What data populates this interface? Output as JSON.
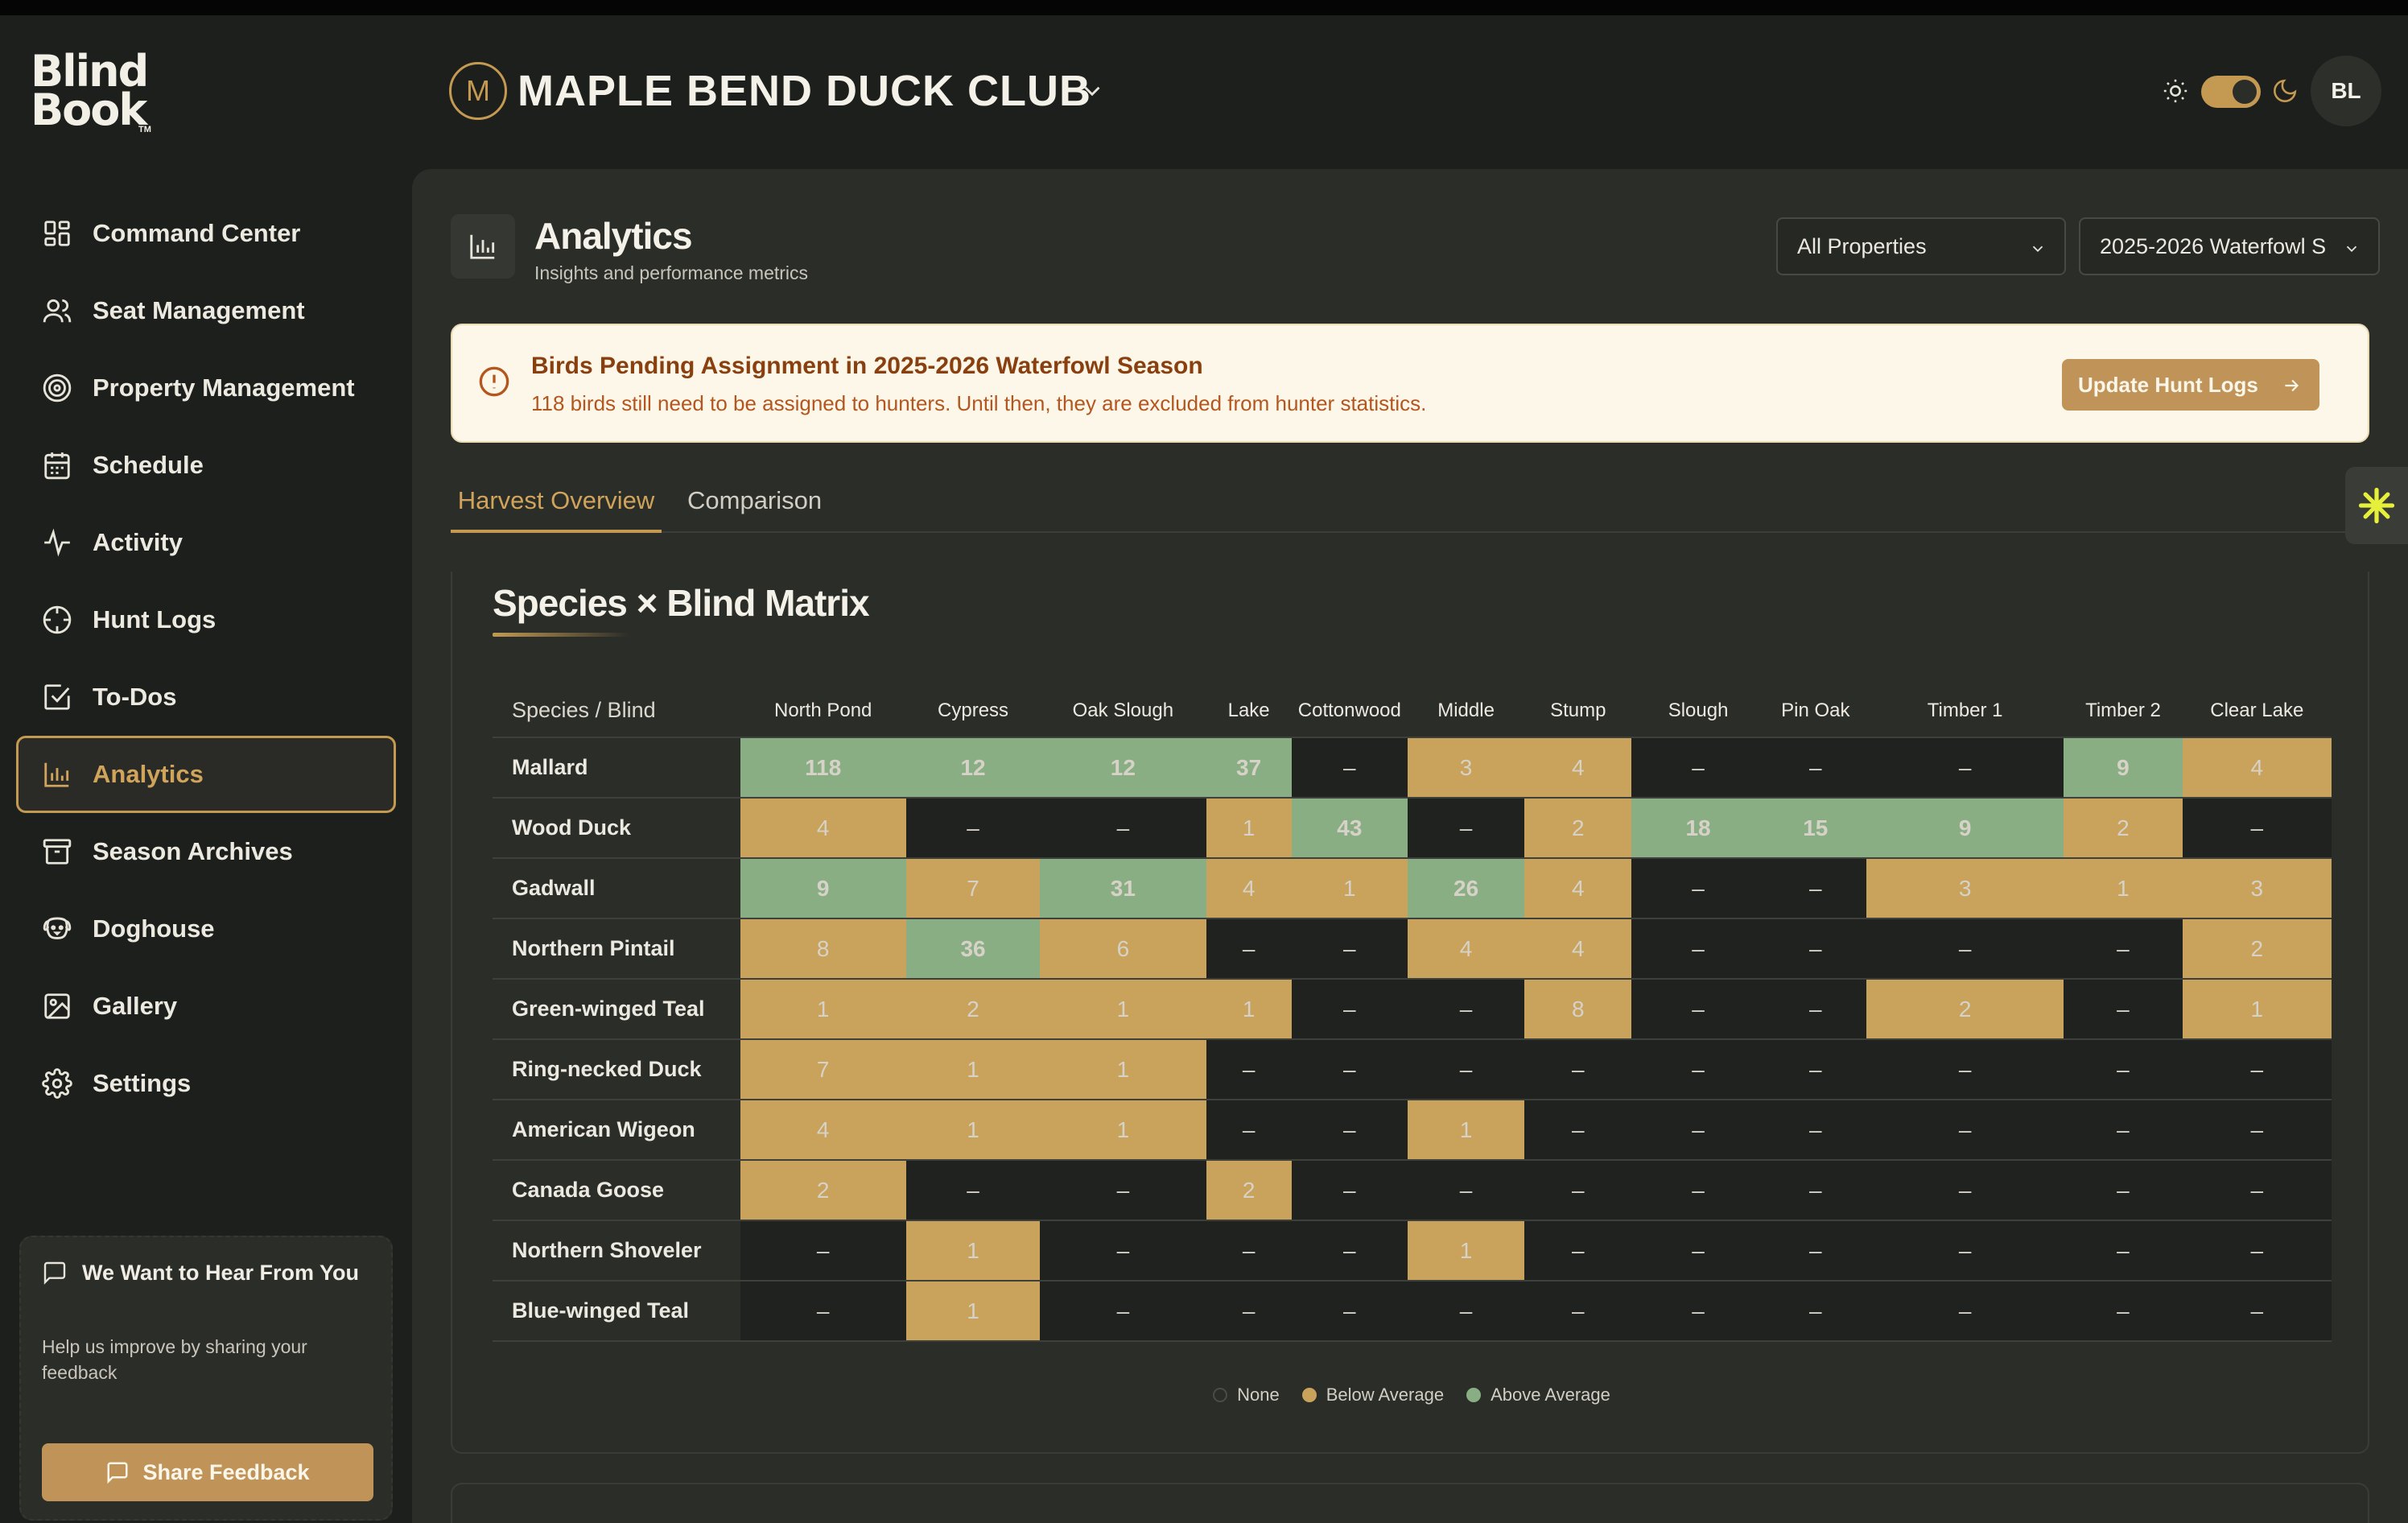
{
  "brand": {
    "line1": "Blind",
    "line2": "Book",
    "tm": "TM"
  },
  "header": {
    "club_initial": "M",
    "club_name": "MAPLE BEND DUCK CLUB",
    "avatar_initials": "BL"
  },
  "sidebar": {
    "items": [
      {
        "label": "Command Center",
        "icon": "grid-icon"
      },
      {
        "label": "Seat Management",
        "icon": "users-icon"
      },
      {
        "label": "Property Management",
        "icon": "target-icon"
      },
      {
        "label": "Schedule",
        "icon": "calendar-icon"
      },
      {
        "label": "Activity",
        "icon": "activity-icon"
      },
      {
        "label": "Hunt Logs",
        "icon": "crosshair-icon"
      },
      {
        "label": "To-Dos",
        "icon": "checkbox-icon"
      },
      {
        "label": "Analytics",
        "icon": "bar-chart-icon",
        "active": true
      },
      {
        "label": "Season Archives",
        "icon": "archive-icon"
      },
      {
        "label": "Doghouse",
        "icon": "dog-icon"
      },
      {
        "label": "Gallery",
        "icon": "image-icon"
      },
      {
        "label": "Settings",
        "icon": "gear-icon"
      }
    ],
    "feedback": {
      "title": "We Want to Hear From You",
      "description": "Help us improve by sharing your feedback",
      "button": "Share Feedback"
    }
  },
  "page": {
    "title": "Analytics",
    "subtitle": "Insights and performance metrics",
    "property_filter": "All Properties",
    "season_filter": "2025-2026 Waterfowl S"
  },
  "alert": {
    "title": "Birds Pending Assignment in 2025-2026 Waterfowl Season",
    "message": "118 birds still need to be assigned to hunters. Until then, they are excluded from hunter statistics.",
    "button": "Update Hunt Logs"
  },
  "tabs": [
    "Harvest Overview",
    "Comparison"
  ],
  "matrix": {
    "title": "Species × Blind Matrix",
    "corner_label": "Species / Blind",
    "columns": [
      "North Pond",
      "Cypress",
      "Oak Slough",
      "Lake",
      "Cottonwood",
      "Middle",
      "Stump",
      "Slough",
      "Pin Oak",
      "Timber 1",
      "Timber 2",
      "Clear Lake"
    ],
    "rows": [
      {
        "species": "Mallard",
        "values": [
          "118",
          "12",
          "12",
          "37",
          "–",
          "3",
          "4",
          "–",
          "–",
          "–",
          "9",
          "4"
        ],
        "levels": [
          "above",
          "above",
          "above",
          "above",
          "none",
          "below",
          "below",
          "none",
          "none",
          "none",
          "above",
          "below"
        ]
      },
      {
        "species": "Wood Duck",
        "values": [
          "4",
          "–",
          "–",
          "1",
          "43",
          "–",
          "2",
          "18",
          "15",
          "9",
          "2",
          "–"
        ],
        "levels": [
          "below",
          "none",
          "none",
          "below",
          "above",
          "none",
          "below",
          "above",
          "above",
          "above",
          "below",
          "none"
        ]
      },
      {
        "species": "Gadwall",
        "values": [
          "9",
          "7",
          "31",
          "4",
          "1",
          "26",
          "4",
          "–",
          "–",
          "3",
          "1",
          "3"
        ],
        "levels": [
          "above",
          "below",
          "above",
          "below",
          "below",
          "above",
          "below",
          "none",
          "none",
          "below",
          "below",
          "below"
        ]
      },
      {
        "species": "Northern Pintail",
        "values": [
          "8",
          "36",
          "6",
          "–",
          "–",
          "4",
          "4",
          "–",
          "–",
          "–",
          "–",
          "2"
        ],
        "levels": [
          "below",
          "above",
          "below",
          "none",
          "none",
          "below",
          "below",
          "none",
          "none",
          "none",
          "none",
          "below"
        ]
      },
      {
        "species": "Green-winged Teal",
        "values": [
          "1",
          "2",
          "1",
          "1",
          "–",
          "–",
          "8",
          "–",
          "–",
          "2",
          "–",
          "1"
        ],
        "levels": [
          "below",
          "below",
          "below",
          "below",
          "none",
          "none",
          "below",
          "none",
          "none",
          "below",
          "none",
          "below"
        ]
      },
      {
        "species": "Ring-necked Duck",
        "values": [
          "7",
          "1",
          "1",
          "–",
          "–",
          "–",
          "–",
          "–",
          "–",
          "–",
          "–",
          "–"
        ],
        "levels": [
          "below",
          "below",
          "below",
          "none",
          "none",
          "none",
          "none",
          "none",
          "none",
          "none",
          "none",
          "none"
        ]
      },
      {
        "species": "American Wigeon",
        "values": [
          "4",
          "1",
          "1",
          "–",
          "–",
          "1",
          "–",
          "–",
          "–",
          "–",
          "–",
          "–"
        ],
        "levels": [
          "below",
          "below",
          "below",
          "none",
          "none",
          "below",
          "none",
          "none",
          "none",
          "none",
          "none",
          "none"
        ]
      },
      {
        "species": "Canada Goose",
        "values": [
          "2",
          "–",
          "–",
          "2",
          "–",
          "–",
          "–",
          "–",
          "–",
          "–",
          "–",
          "–"
        ],
        "levels": [
          "below",
          "none",
          "none",
          "below",
          "none",
          "none",
          "none",
          "none",
          "none",
          "none",
          "none",
          "none"
        ]
      },
      {
        "species": "Northern Shoveler",
        "values": [
          "–",
          "1",
          "–",
          "–",
          "–",
          "1",
          "–",
          "–",
          "–",
          "–",
          "–",
          "–"
        ],
        "levels": [
          "none",
          "below",
          "none",
          "none",
          "none",
          "below",
          "none",
          "none",
          "none",
          "none",
          "none",
          "none"
        ]
      },
      {
        "species": "Blue-winged Teal",
        "values": [
          "–",
          "1",
          "–",
          "–",
          "–",
          "–",
          "–",
          "–",
          "–",
          "–",
          "–",
          "–"
        ],
        "levels": [
          "none",
          "below",
          "none",
          "none",
          "none",
          "none",
          "none",
          "none",
          "none",
          "none",
          "none",
          "none"
        ]
      }
    ],
    "legend": [
      {
        "label": "None",
        "color": "#2b2d29"
      },
      {
        "label": "Below Average",
        "color": "#c9a25c"
      },
      {
        "label": "Above Average",
        "color": "#8aae84"
      }
    ]
  },
  "colors": {
    "accent": "#c49a52",
    "below_average": "#c9a25c",
    "above_average": "#8aae84",
    "alert_text": "#8a3f0f"
  }
}
